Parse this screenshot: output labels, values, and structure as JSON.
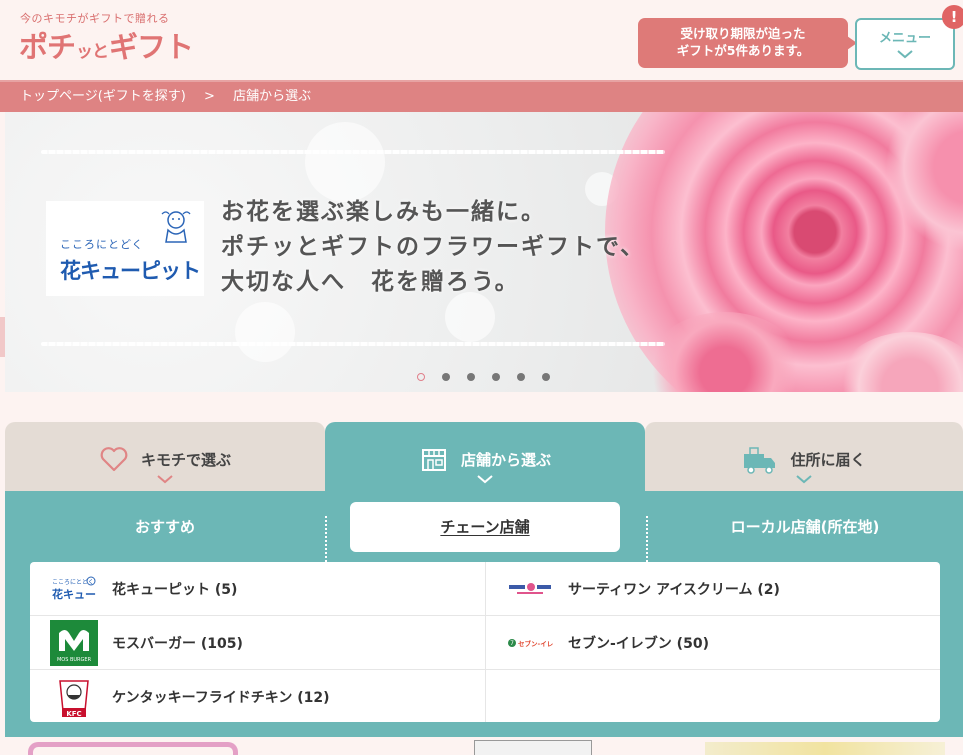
{
  "header": {
    "tagline": "今のキモチがギフトで贈れる",
    "logo_part1": "ポチ",
    "logo_part2": "ッと",
    "logo_part3": "ギフト",
    "notice_line1": "受け取り期限が迫った",
    "notice_line2": "ギフトが5件あります。",
    "menu_label": "メニュー",
    "badge": "!"
  },
  "breadcrumb": {
    "home": "トップページ(ギフトを探す)",
    "separator": ">",
    "current": "店舗から選ぶ"
  },
  "hero": {
    "brand_sub": "こころにとどく",
    "brand_name": "花キューピット",
    "copy_line1": "お花を選ぶ楽しみも一緒に。",
    "copy_line2": "ポチッとギフトのフラワーギフトで、",
    "copy_line3": "大切な人へ　花を贈ろう。",
    "slide_count": 6,
    "active_slide": 1
  },
  "tabs": [
    {
      "label": "キモチで選ぶ",
      "icon": "heart-icon",
      "active": false
    },
    {
      "label": "店舗から選ぶ",
      "icon": "store-icon",
      "active": true
    },
    {
      "label": "住所に届く",
      "icon": "delivery-truck-icon",
      "active": false
    }
  ],
  "subtabs": [
    {
      "label": "おすすめ",
      "active": false
    },
    {
      "label": "チェーン店舗",
      "active": true
    },
    {
      "label": "ローカル店舗(所在地)",
      "active": false
    }
  ],
  "stores": [
    {
      "name": "花キューピット (5)",
      "logo": "hana-cupid-logo"
    },
    {
      "name": "サーティワン アイスクリーム (2)",
      "logo": "baskin-robbins-logo"
    },
    {
      "name": "モスバーガー (105)",
      "logo": "mos-burger-logo"
    },
    {
      "name": "セブン-イレブン (50)",
      "logo": "seven-eleven-logo"
    },
    {
      "name": "ケンタッキーフライドチキン (12)",
      "logo": "kfc-logo"
    }
  ],
  "logo_texts": {
    "mos": "MOS BURGER",
    "kfc": "KFC",
    "seven": "セブン-イレブン"
  },
  "colors": {
    "brand_pink": "#e07474",
    "breadcrumb": "#de8383",
    "teal": "#6cb7b6",
    "tab_inactive": "#e4dcd5"
  }
}
